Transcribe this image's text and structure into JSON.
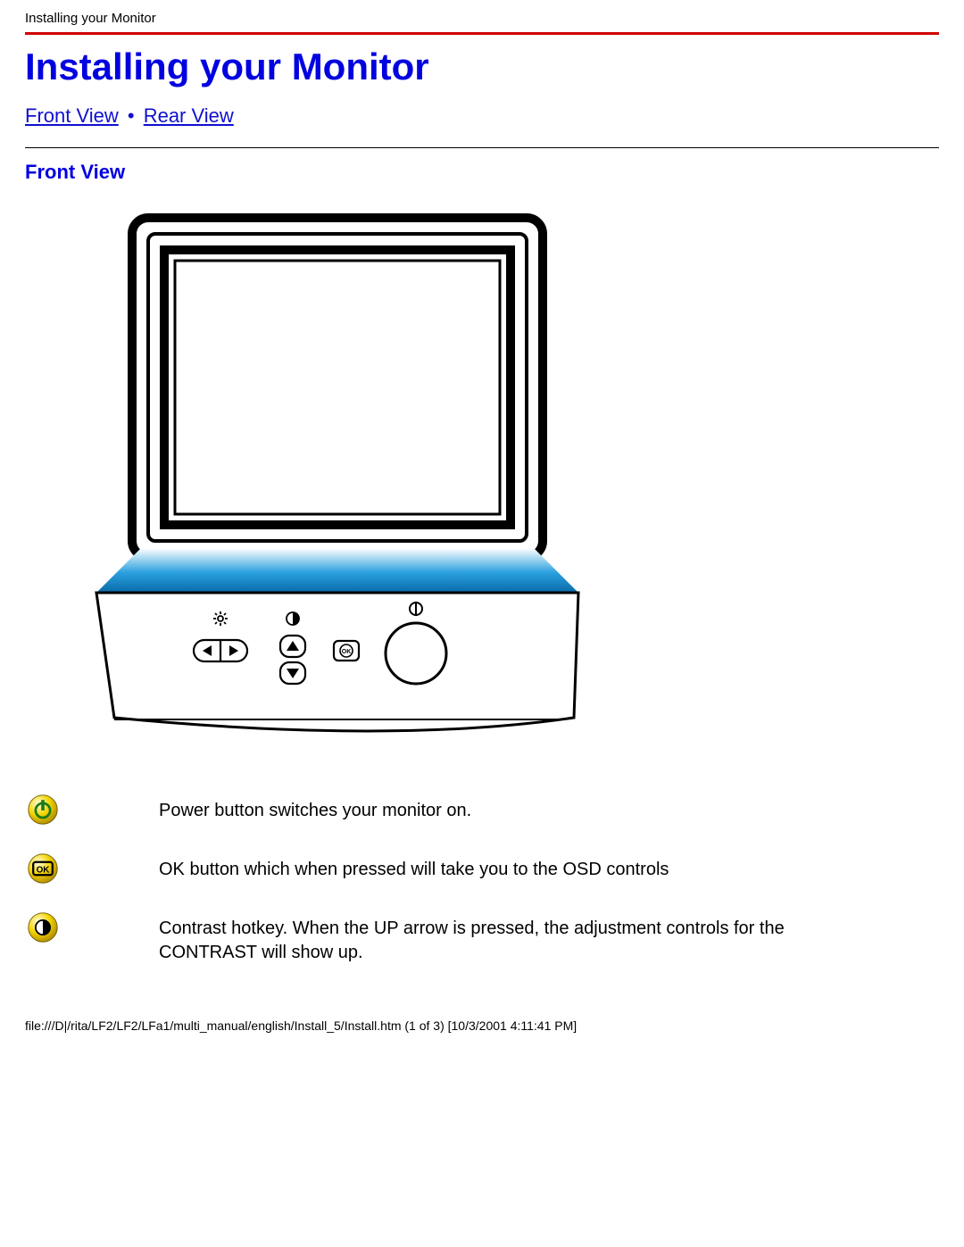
{
  "header": "Installing your Monitor",
  "title": "Installing your Monitor",
  "nav": {
    "front": "Front View",
    "sep": "•",
    "rear": "Rear View"
  },
  "section": {
    "front_head": "Front View"
  },
  "legend": {
    "power": "Power button switches your monitor on.",
    "ok": "OK button which when pressed will take you to the OSD controls",
    "contrast": "Contrast hotkey. When the UP arrow is pressed, the adjustment controls for the CONTRAST will show up."
  },
  "footer": "file:///D|/rita/LF2/LF2/LFa1/multi_manual/english/Install_5/Install.htm (1 of 3) [10/3/2001 4:11:41 PM]"
}
